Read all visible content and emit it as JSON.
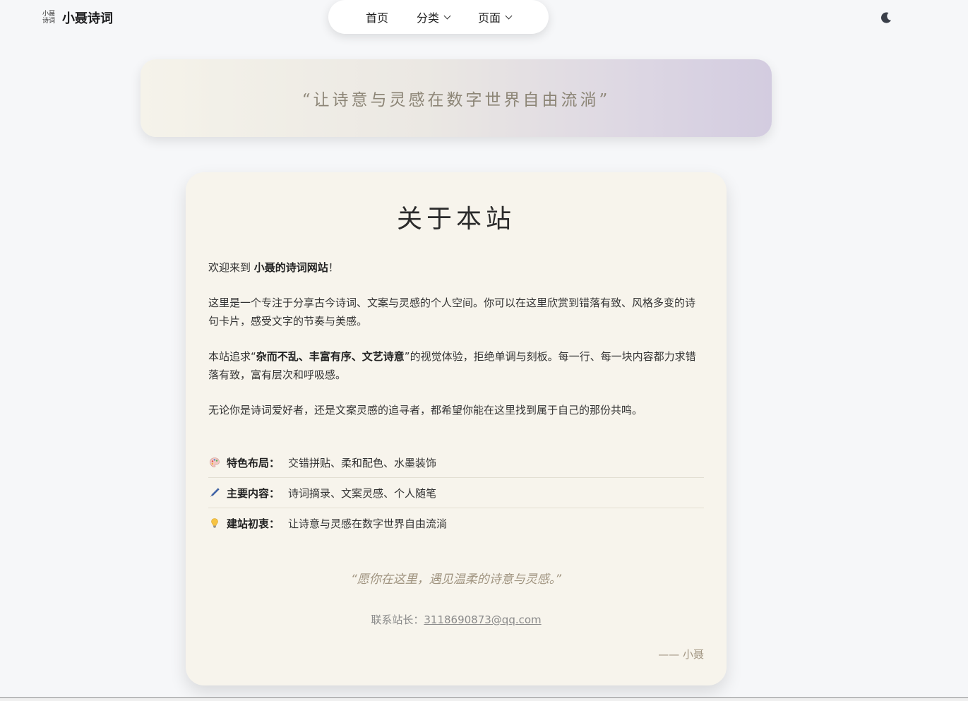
{
  "header": {
    "logo_line1": "小聂",
    "logo_line2": "诗词",
    "site_title": "小聂诗词",
    "nav": [
      {
        "label": "首页"
      },
      {
        "label": "分类"
      },
      {
        "label": "页面"
      }
    ],
    "theme_icon": "moon-icon"
  },
  "banner": {
    "quote": "“让诗意与灵感在数字世界自由流淌”"
  },
  "about": {
    "title": "关于本站",
    "p1_prefix": "欢迎来到 ",
    "p1_bold": "小聂的诗词网站",
    "p1_suffix": "！",
    "p2": "这里是一个专注于分享古今诗词、文案与灵感的个人空间。你可以在这里欣赏到错落有致、风格多变的诗句卡片，感受文字的节奏与美感。",
    "p3_prefix": "本站追求“",
    "p3_bold": "杂而不乱、丰富有序、文艺诗意",
    "p3_suffix": "”的视觉体验，拒绝单调与刻板。每一行、每一块内容都力求错落有致，富有层次和呼吸感。",
    "p4": "无论你是诗词爱好者，还是文案灵感的追寻者，都希望你能在这里找到属于自己的那份共鸣。",
    "features": [
      {
        "icon": "palette-icon",
        "label": "特色布局：",
        "value": "交错拼贴、柔和配色、水墨装饰"
      },
      {
        "icon": "pen-icon",
        "label": "主要内容：",
        "value": "诗词摘录、文案灵感、个人随笔"
      },
      {
        "icon": "lightbulb-icon",
        "label": "建站初衷：",
        "value": "让诗意与灵感在数字世界自由流淌"
      }
    ],
    "quote": "“愿你在这里，遇见温柔的诗意与灵感。”",
    "contact_label": "联系站长：",
    "contact_email": "3118690873@qq.com",
    "signature": "—— 小聂"
  },
  "colors": {
    "page_bg": "#f6f7f9",
    "card_bg": "#f7f4ec",
    "accent_text": "#a09480"
  }
}
